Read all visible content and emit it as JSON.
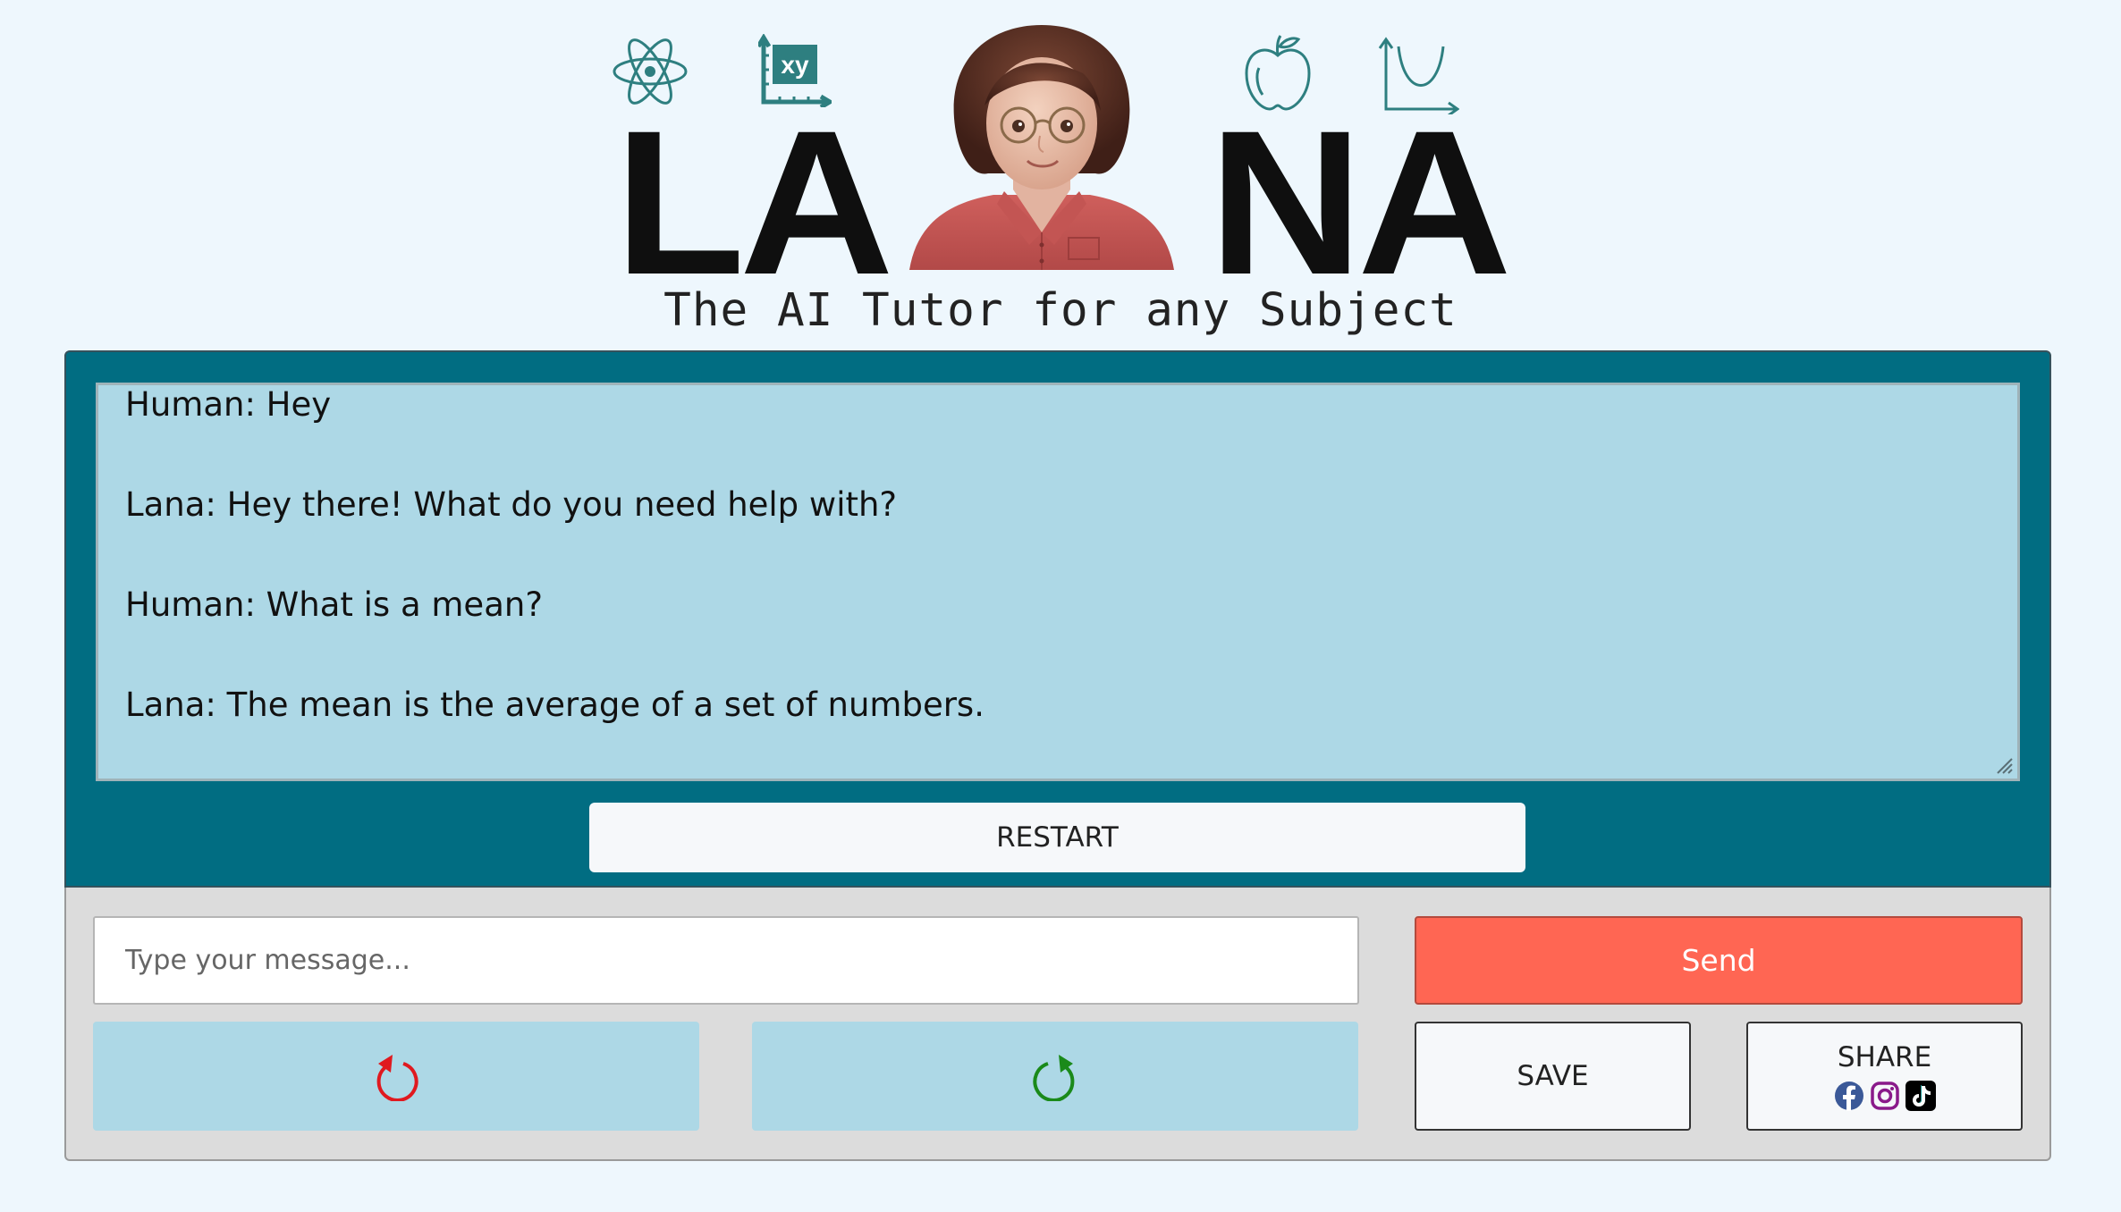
{
  "header": {
    "logo_left": "LA",
    "logo_right": "NA",
    "tagline": "The AI Tutor for any Subject",
    "graph_icon_label": "xy"
  },
  "chat": {
    "messages": [
      "Human: Hey",
      "Lana: Hey there! What do you need help with?",
      "Human: What is a mean?",
      "Lana: The mean is the average of a set of numbers."
    ],
    "restart_label": "RESTART"
  },
  "controls": {
    "input_placeholder": "Type your message...",
    "input_value": "",
    "send_label": "Send",
    "save_label": "SAVE",
    "share_label": "SHARE"
  },
  "colors": {
    "chat_panel": "#016d82",
    "transcript_bg": "#add8e6",
    "send_button": "#ff6653",
    "undo_icon": "#e0191f",
    "redo_icon": "#1a8a1a",
    "facebook": "#3b5998",
    "instagram": "#8a1a8a",
    "tiktok": "#000000"
  },
  "icons": {
    "undo": "rotate-ccw-icon",
    "redo": "rotate-cw-icon",
    "share": [
      "facebook-icon",
      "instagram-icon",
      "tiktok-icon"
    ]
  }
}
